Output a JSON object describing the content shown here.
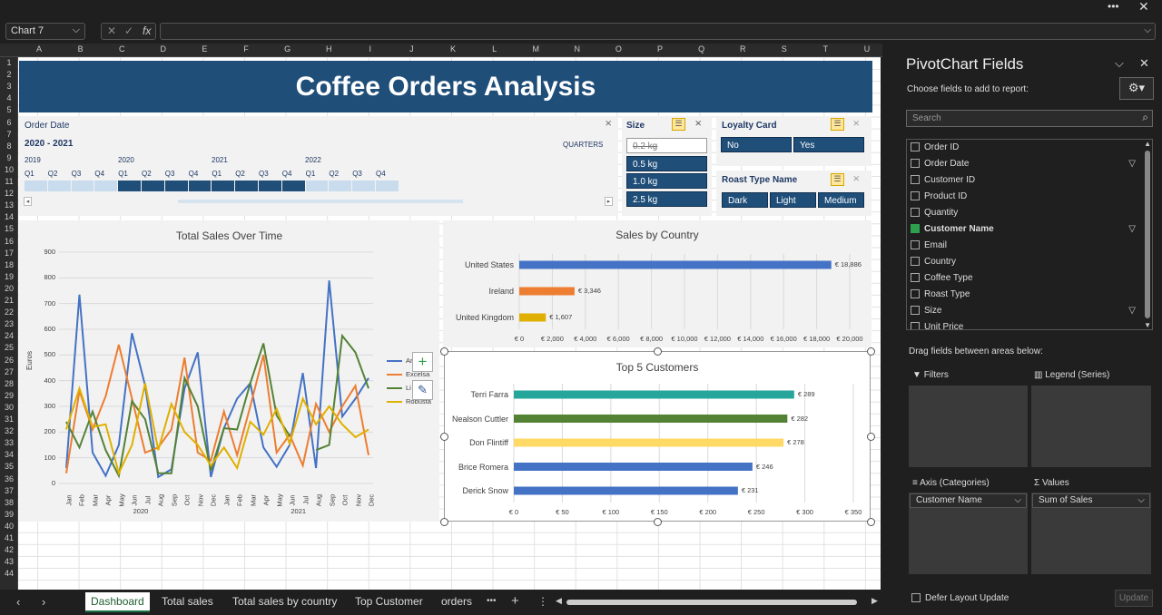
{
  "namebox": "Chart 7",
  "fx": "fx",
  "columns": [
    "A",
    "B",
    "C",
    "D",
    "E",
    "F",
    "G",
    "H",
    "I",
    "J",
    "K",
    "L",
    "M",
    "N",
    "O",
    "P",
    "Q",
    "R",
    "S",
    "T",
    "U"
  ],
  "rows": [
    "1",
    "2",
    "3",
    "4",
    "5",
    "6",
    "7",
    "8",
    "9",
    "10",
    "11",
    "12",
    "13",
    "14",
    "15",
    "16",
    "17",
    "18",
    "19",
    "20",
    "21",
    "22",
    "23",
    "24",
    "25",
    "26",
    "27",
    "28",
    "29",
    "30",
    "31",
    "32",
    "33",
    "34",
    "35",
    "36",
    "37",
    "38",
    "39",
    "40",
    "41",
    "42",
    "43",
    "44"
  ],
  "dashboard": {
    "title": "Coffee Orders Analysis",
    "timeline": {
      "label": "Order Date",
      "range": "2020 - 2021",
      "unit": "QUARTERS",
      "years": [
        "2019",
        "2020",
        "2021",
        "2022"
      ],
      "quarters": [
        "Q1",
        "Q2",
        "Q3",
        "Q4",
        "Q1",
        "Q2",
        "Q3",
        "Q4",
        "Q1",
        "Q2",
        "Q3",
        "Q4",
        "Q1",
        "Q2",
        "Q3",
        "Q4"
      ]
    },
    "size": {
      "title": "Size",
      "items": [
        "0.2 kg",
        "0.5 kg",
        "1.0 kg",
        "2.5 kg"
      ]
    },
    "loyalty": {
      "title": "Loyalty Card",
      "items": [
        "No",
        "Yes"
      ]
    },
    "roast": {
      "title": "Roast Type Name",
      "items": [
        "Dark",
        "Light",
        "Medium"
      ]
    }
  },
  "chart_data": [
    {
      "type": "line",
      "title": "Total Sales Over Time",
      "ylabel": "Euros",
      "ylim": [
        0,
        900
      ],
      "yticks": [
        "0",
        "100",
        "200",
        "300",
        "400",
        "500",
        "600",
        "700",
        "800",
        "900"
      ],
      "categories": [
        "Jan",
        "Feb",
        "Mar",
        "Apr",
        "May",
        "Jun",
        "Jul",
        "Aug",
        "Sep",
        "Oct",
        "Nov",
        "Dec",
        "Jan",
        "Feb",
        "Mar",
        "Apr",
        "May",
        "Jun",
        "Jul",
        "Aug",
        "Sep",
        "Oct",
        "Nov",
        "Dec"
      ],
      "year_labels": [
        "2020",
        "2021"
      ],
      "legend": [
        "Ar",
        "Excelsa",
        "Li",
        "Robusta"
      ],
      "colors": [
        "#4472c4",
        "#ed7d31",
        "#548235",
        "#e0b000"
      ],
      "series": [
        {
          "name": "Ar",
          "values": [
            60,
            735,
            120,
            30,
            150,
            585,
            380,
            25,
            55,
            370,
            510,
            25,
            215,
            330,
            390,
            140,
            65,
            150,
            430,
            60,
            790,
            260,
            330,
            410
          ]
        },
        {
          "name": "Excelsa",
          "values": [
            40,
            360,
            210,
            340,
            540,
            330,
            120,
            140,
            210,
            490,
            120,
            90,
            280,
            110,
            300,
            500,
            120,
            190,
            70,
            310,
            200,
            300,
            380,
            110
          ]
        },
        {
          "name": "Li",
          "values": [
            240,
            140,
            280,
            130,
            30,
            320,
            250,
            40,
            40,
            410,
            300,
            50,
            215,
            210,
            390,
            545,
            265,
            185,
            null,
            130,
            150,
            575,
            510,
            370
          ]
        },
        {
          "name": "Robusta",
          "values": [
            210,
            370,
            220,
            230,
            40,
            150,
            390,
            130,
            310,
            200,
            150,
            70,
            140,
            60,
            240,
            190,
            290,
            155,
            330,
            230,
            300,
            230,
            180,
            210
          ]
        }
      ]
    },
    {
      "type": "bar",
      "title": "Sales by Country",
      "categories": [
        "United States",
        "Ireland",
        "United Kingdom"
      ],
      "values": [
        18886,
        3346,
        1607
      ],
      "labels": [
        "€ 18,886",
        "€ 3,346",
        "€ 1,607"
      ],
      "colors": [
        "#4472c4",
        "#ed7d31",
        "#e0b000"
      ],
      "xlim": [
        0,
        20000
      ],
      "xticks": [
        "€ 0",
        "€ 2,000",
        "€ 4,000",
        "€ 6,000",
        "€ 8,000",
        "€ 10,000",
        "€ 12,000",
        "€ 14,000",
        "€ 16,000",
        "€ 18,000",
        "€ 20,000"
      ]
    },
    {
      "type": "bar",
      "title": "Top 5 Customers",
      "categories": [
        "Terri Farra",
        "Nealson Cuttler",
        "Don Flintiff",
        "Brice Romera",
        "Derick Snow"
      ],
      "values": [
        289,
        282,
        278,
        246,
        231
      ],
      "labels": [
        "€ 289",
        "€ 282",
        "€ 278",
        "€ 246",
        "€ 231"
      ],
      "colors": [
        "#26a69a",
        "#548235",
        "#ffd966",
        "#4472c4",
        "#4472c4"
      ],
      "xlim": [
        0,
        350
      ],
      "xticks": [
        "€ 0",
        "€ 50",
        "€ 100",
        "€ 150",
        "€ 200",
        "€ 250",
        "€ 300",
        "€ 350"
      ]
    }
  ],
  "sheets": [
    "Dashboard",
    "Total sales",
    "Total sales by country",
    "Top Customer",
    "orders"
  ],
  "sheet_more": "•••",
  "sheet_add": "+",
  "pane": {
    "title": "PivotChart Fields",
    "subtitle": "Choose fields to add to report:",
    "search_placeholder": "Search",
    "fields": [
      {
        "label": "Order ID",
        "checked": false,
        "filter": false
      },
      {
        "label": "Order Date",
        "checked": false,
        "filter": true
      },
      {
        "label": "Customer ID",
        "checked": false,
        "filter": false
      },
      {
        "label": "Product ID",
        "checked": false,
        "filter": false
      },
      {
        "label": "Quantity",
        "checked": false,
        "filter": false
      },
      {
        "label": "Customer Name",
        "checked": true,
        "filter": true
      },
      {
        "label": "Email",
        "checked": false,
        "filter": false
      },
      {
        "label": "Country",
        "checked": false,
        "filter": false
      },
      {
        "label": "Coffee Type",
        "checked": false,
        "filter": false
      },
      {
        "label": "Roast Type",
        "checked": false,
        "filter": false
      },
      {
        "label": "Size",
        "checked": false,
        "filter": true
      },
      {
        "label": "Unit Price",
        "checked": false,
        "filter": false
      }
    ],
    "drag_hint": "Drag fields between areas below:",
    "areas": {
      "filters": "Filters",
      "legend": "Legend (Series)",
      "axis": "Axis (Categories)",
      "values": "Values"
    },
    "axis_field": "Customer Name",
    "values_field": "Sum of Sales",
    "defer": "Defer Layout Update",
    "update": "Update"
  }
}
